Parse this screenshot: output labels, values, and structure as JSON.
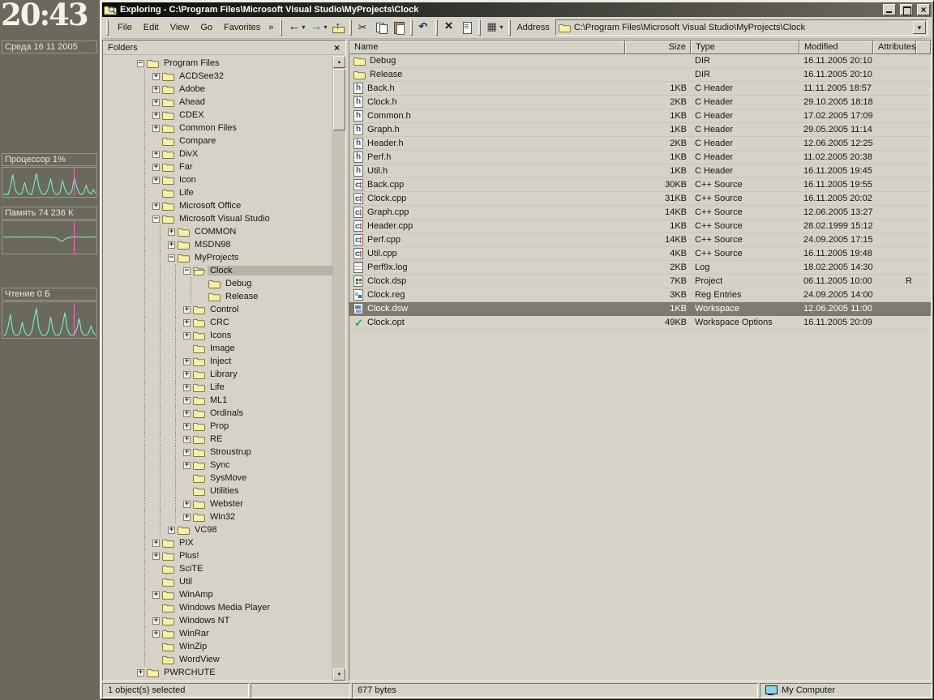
{
  "desktop": {
    "clock": "20:43",
    "date": "Среда 16 11 2005",
    "accent_color": "#72ffcf",
    "marker_color": "#ff63cf",
    "monitors": [
      {
        "label": "Процессор 1%",
        "icon": "cpu-graph",
        "points": [
          3,
          6,
          2,
          35,
          88,
          25,
          8,
          4,
          12,
          55,
          18,
          6,
          3,
          45,
          92,
          38,
          10,
          4,
          8,
          30,
          70,
          22,
          6,
          3,
          15,
          60,
          28,
          8,
          4,
          20,
          75,
          35,
          9,
          3,
          10,
          42,
          14,
          5,
          25,
          8
        ]
      },
      {
        "label": "Память 74 236 К",
        "icon": "memory-graph",
        "points": [
          56,
          56,
          55,
          56,
          56,
          57,
          56,
          55,
          56,
          56,
          55,
          56,
          57,
          56,
          56,
          55,
          56,
          56,
          55,
          55,
          56,
          55,
          54,
          50,
          42,
          40,
          47,
          53,
          55,
          56,
          56,
          57,
          56,
          56,
          55,
          56,
          56,
          57,
          56,
          56
        ]
      },
      {
        "label": "Чтение 0 Б",
        "icon": "disk-read-graph",
        "points": [
          2,
          5,
          30,
          75,
          18,
          4,
          2,
          10,
          48,
          15,
          3,
          2,
          14,
          58,
          95,
          28,
          6,
          2,
          4,
          18,
          65,
          20,
          4,
          2,
          8,
          36,
          80,
          24,
          5,
          2,
          6,
          22,
          60,
          16,
          4,
          2,
          10,
          34,
          12,
          3
        ]
      }
    ]
  },
  "window": {
    "title": "Exploring - C:\\Program Files\\Microsoft Visual Studio\\MyProjects\\Clock",
    "menus": [
      "File",
      "Edit",
      "View",
      "Go",
      "Favorites"
    ],
    "chevron": "»",
    "address_label": "Address",
    "address_value": "C:\\Program Files\\Microsoft Visual Studio\\MyProjects\\Clock",
    "toolbar": [
      {
        "name": "back",
        "icon": "back-arrow-icon",
        "caret": true
      },
      {
        "name": "forward",
        "icon": "forward-arrow-icon",
        "caret": true
      },
      {
        "name": "up",
        "icon": "up-folder-icon"
      },
      "|",
      {
        "name": "cut",
        "icon": "cut-scissors-icon"
      },
      {
        "name": "copy",
        "icon": "copy-icon"
      },
      {
        "name": "paste",
        "icon": "paste-clipboard-icon"
      },
      "|",
      {
        "name": "undo",
        "icon": "undo-arrow-icon"
      },
      "|",
      {
        "name": "delete",
        "icon": "delete-x-icon"
      },
      {
        "name": "properties",
        "icon": "properties-sheet-icon"
      },
      "|",
      {
        "name": "views",
        "icon": "views-grid-icon",
        "caret": true
      }
    ]
  },
  "folders_pane": {
    "header": "Folders",
    "tree": [
      {
        "level": 0,
        "expand": "-",
        "label": "Program Files"
      },
      {
        "level": 1,
        "expand": "+",
        "label": "ACDSee32"
      },
      {
        "level": 1,
        "expand": "+",
        "label": "Adobe"
      },
      {
        "level": 1,
        "expand": "+",
        "label": "Ahead"
      },
      {
        "level": 1,
        "expand": "+",
        "label": "CDEX"
      },
      {
        "level": 1,
        "expand": "+",
        "label": "Common Files"
      },
      {
        "level": 1,
        "expand": "",
        "label": "Compare"
      },
      {
        "level": 1,
        "expand": "+",
        "label": "DivX"
      },
      {
        "level": 1,
        "expand": "+",
        "label": "Far"
      },
      {
        "level": 1,
        "expand": "+",
        "label": "Icon"
      },
      {
        "level": 1,
        "expand": "",
        "label": "Life"
      },
      {
        "level": 1,
        "expand": "+",
        "label": "Microsoft Office"
      },
      {
        "level": 1,
        "expand": "-",
        "label": "Microsoft Visual Studio"
      },
      {
        "level": 2,
        "expand": "+",
        "label": "COMMON"
      },
      {
        "level": 2,
        "expand": "+",
        "label": "MSDN98"
      },
      {
        "level": 2,
        "expand": "-",
        "label": "MyProjects"
      },
      {
        "level": 3,
        "expand": "-",
        "label": "Clock",
        "selected": true,
        "open": true
      },
      {
        "level": 4,
        "expand": "",
        "label": "Debug"
      },
      {
        "level": 4,
        "expand": "",
        "label": "Release"
      },
      {
        "level": 3,
        "expand": "+",
        "label": "Control"
      },
      {
        "level": 3,
        "expand": "+",
        "label": "CRC"
      },
      {
        "level": 3,
        "expand": "+",
        "label": "Icons"
      },
      {
        "level": 3,
        "expand": "",
        "label": "Image"
      },
      {
        "level": 3,
        "expand": "+",
        "label": "Inject"
      },
      {
        "level": 3,
        "expand": "+",
        "label": "Library"
      },
      {
        "level": 3,
        "expand": "+",
        "label": "Life"
      },
      {
        "level": 3,
        "expand": "+",
        "label": "ML1"
      },
      {
        "level": 3,
        "expand": "+",
        "label": "Ordinals"
      },
      {
        "level": 3,
        "expand": "+",
        "label": "Prop"
      },
      {
        "level": 3,
        "expand": "+",
        "label": "RE"
      },
      {
        "level": 3,
        "expand": "+",
        "label": "Stroustrup"
      },
      {
        "level": 3,
        "expand": "+",
        "label": "Sync"
      },
      {
        "level": 3,
        "expand": "",
        "label": "SysMove"
      },
      {
        "level": 3,
        "expand": "",
        "label": "Utilities"
      },
      {
        "level": 3,
        "expand": "+",
        "label": "Webster"
      },
      {
        "level": 3,
        "expand": "+",
        "label": "Win32"
      },
      {
        "level": 2,
        "expand": "+",
        "label": "VC98"
      },
      {
        "level": 1,
        "expand": "+",
        "label": "PIX"
      },
      {
        "level": 1,
        "expand": "+",
        "label": "Plus!"
      },
      {
        "level": 1,
        "expand": "",
        "label": "SciTE"
      },
      {
        "level": 1,
        "expand": "",
        "label": "Util"
      },
      {
        "level": 1,
        "expand": "+",
        "label": "WinAmp"
      },
      {
        "level": 1,
        "expand": "",
        "label": "Windows Media Player"
      },
      {
        "level": 1,
        "expand": "+",
        "label": "Windows NT"
      },
      {
        "level": 1,
        "expand": "+",
        "label": "WinRar"
      },
      {
        "level": 1,
        "expand": "",
        "label": "WinZip"
      },
      {
        "level": 1,
        "expand": "",
        "label": "WordView"
      },
      {
        "level": 0,
        "expand": "+",
        "label": "PWRCHUTE"
      }
    ]
  },
  "file_list": {
    "columns": [
      "Name",
      "Size",
      "Type",
      "Modified",
      "Attributes"
    ],
    "rows": [
      {
        "name": "Debug",
        "size": "",
        "type": "DIR",
        "modified": "16.11.2005 20:10",
        "attr": "",
        "icon": "folder-icon"
      },
      {
        "name": "Release",
        "size": "",
        "type": "DIR",
        "modified": "16.11.2005 20:10",
        "attr": "",
        "icon": "folder-icon"
      },
      {
        "name": "Back.h",
        "size": "1KB",
        "type": "C Header",
        "modified": "11.11.2005 18:57",
        "attr": "",
        "icon": "c-header-icon"
      },
      {
        "name": "Clock.h",
        "size": "2KB",
        "type": "C Header",
        "modified": "29.10.2005 18:18",
        "attr": "",
        "icon": "c-header-icon"
      },
      {
        "name": "Common.h",
        "size": "1KB",
        "type": "C Header",
        "modified": "17.02.2005 17:09",
        "attr": "",
        "icon": "c-header-icon"
      },
      {
        "name": "Graph.h",
        "size": "1KB",
        "type": "C Header",
        "modified": "29.05.2005 11:14",
        "attr": "",
        "icon": "c-header-icon"
      },
      {
        "name": "Header.h",
        "size": "2KB",
        "type": "C Header",
        "modified": "12.06.2005 12:25",
        "attr": "",
        "icon": "c-header-icon"
      },
      {
        "name": "Perf.h",
        "size": "1KB",
        "type": "C Header",
        "modified": "11.02.2005 20:38",
        "attr": "",
        "icon": "c-header-icon"
      },
      {
        "name": "Util.h",
        "size": "1KB",
        "type": "C Header",
        "modified": "16.11.2005 19:45",
        "attr": "",
        "icon": "c-header-icon"
      },
      {
        "name": "Back.cpp",
        "size": "30KB",
        "type": "C++ Source",
        "modified": "16.11.2005 19:55",
        "attr": "",
        "icon": "cpp-source-icon"
      },
      {
        "name": "Clock.cpp",
        "size": "31KB",
        "type": "C++ Source",
        "modified": "16.11.2005 20:02",
        "attr": "",
        "icon": "cpp-source-icon"
      },
      {
        "name": "Graph.cpp",
        "size": "14KB",
        "type": "C++ Source",
        "modified": "12.06.2005 13:27",
        "attr": "",
        "icon": "cpp-source-icon"
      },
      {
        "name": "Header.cpp",
        "size": "1KB",
        "type": "C++ Source",
        "modified": "28.02.1999 15:12",
        "attr": "",
        "icon": "cpp-source-icon"
      },
      {
        "name": "Perf.cpp",
        "size": "14KB",
        "type": "C++ Source",
        "modified": "24.09.2005 17:15",
        "attr": "",
        "icon": "cpp-source-icon"
      },
      {
        "name": "Util.cpp",
        "size": "4KB",
        "type": "C++ Source",
        "modified": "16.11.2005 19:48",
        "attr": "",
        "icon": "cpp-source-icon"
      },
      {
        "name": "Perf9x.log",
        "size": "2KB",
        "type": "Log",
        "modified": "18.02.2005 14:30",
        "attr": "",
        "icon": "log-icon"
      },
      {
        "name": "Clock.dsp",
        "size": "7KB",
        "type": "Project",
        "modified": "06.11.2005 10:00",
        "attr": "R",
        "icon": "project-icon"
      },
      {
        "name": "Clock.reg",
        "size": "3KB",
        "type": "Reg Entries",
        "modified": "24.09.2005 14:00",
        "attr": "",
        "icon": "reg-icon"
      },
      {
        "name": "Clock.dsw",
        "size": "1KB",
        "type": "Workspace",
        "modified": "12.06.2005 11:00",
        "attr": "",
        "icon": "workspace-icon",
        "selected": true
      },
      {
        "name": "Clock.opt",
        "size": "49KB",
        "type": "Workspace Options",
        "modified": "16.11.2005 20:09",
        "attr": "",
        "icon": "options-icon"
      }
    ]
  },
  "status_bar": {
    "left": "1 object(s) selected",
    "middle": "677 bytes",
    "right": "My Computer"
  }
}
